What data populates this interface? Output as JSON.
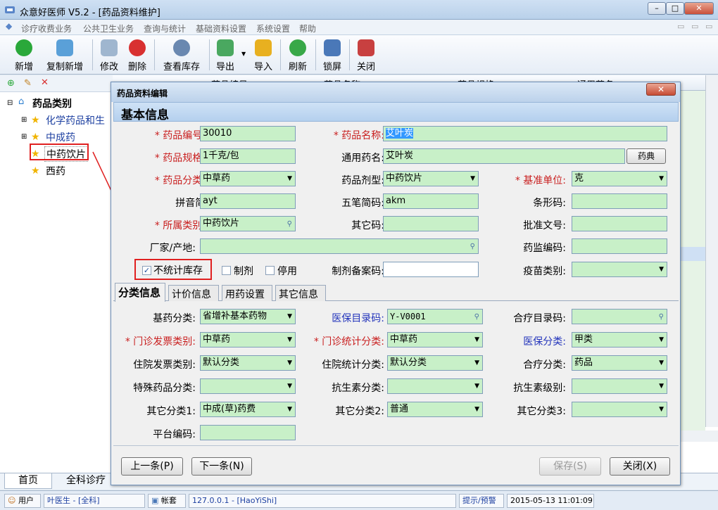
{
  "window": {
    "title": "众意好医师 V5.2 - [药品资料维护]"
  },
  "menu": [
    "诊疗收费业务",
    "公共卫生业务",
    "查询与统计",
    "基础资料设置",
    "系统设置",
    "帮助"
  ],
  "toolbar": [
    {
      "label": "新增",
      "icon": "add-icon"
    },
    {
      "label": "复制新增",
      "icon": "copy-icon"
    },
    {
      "label": "修改",
      "icon": "edit-icon"
    },
    {
      "label": "删除",
      "icon": "delete-icon"
    },
    {
      "label": "查看库存",
      "icon": "inventory-icon"
    },
    {
      "label": "导出",
      "icon": "export-icon"
    },
    {
      "label": "导入",
      "icon": "import-icon"
    },
    {
      "label": "刷新",
      "icon": "refresh-icon"
    },
    {
      "label": "锁屏",
      "icon": "lock-screen-icon"
    },
    {
      "label": "关闭",
      "icon": "exit-icon"
    }
  ],
  "tree": {
    "root": "药品类别",
    "items": [
      "化学药品和生",
      "中成药",
      "中药饮片",
      "西药"
    ]
  },
  "bottom_tabs": [
    "首页",
    "全科诊疗"
  ],
  "status": {
    "user_label": "用户",
    "user": "叶医生 - [全科]",
    "account_label": "帐套",
    "account": "127.0.0.1 - [HaoYiShi]",
    "hint": "提示/预警",
    "datetime": "2015-05-13 11:01:09"
  },
  "dialog": {
    "title": "药品资料编辑",
    "close": "✕",
    "section": "基本信息",
    "labels": {
      "code": "药品编号:",
      "name": "药品名称:",
      "spec": "药品规格:",
      "generic": "通用药名:",
      "category": "药品分类:",
      "dosage": "药品剂型:",
      "unit": "基准单位:",
      "pinyin": "拼音简码:",
      "wubi": "五笔简码:",
      "barcode": "条形码:",
      "subcat": "所属类别:",
      "othercode": "其它码:",
      "approval": "批准文号:",
      "maker": "厂家/产地:",
      "supervision": "药监编码:",
      "nostock": "不统计库存",
      "prep": "制剂",
      "stopped": "停用",
      "prep_record": "制剂备案码:",
      "vaccine": "疫苗类别:"
    },
    "values": {
      "code": "30010",
      "name": "艾叶炭",
      "spec": "1千克/包",
      "generic": "艾叶炭",
      "category": "中草药",
      "dosage": "中药饮片",
      "unit": "克",
      "pinyin": "ayt",
      "wubi": "akm",
      "barcode": "",
      "subcat": "中药饮片",
      "othercode": "",
      "approval": "",
      "maker": "",
      "supervision": "",
      "prep_record": "",
      "vaccine": ""
    },
    "checks": {
      "nostock": true,
      "prep": false,
      "stopped": false
    },
    "pharmacopoeia_button": "药典",
    "tabs": [
      "分类信息",
      "计价信息",
      "用药设置",
      "其它信息"
    ],
    "class_labels": {
      "basic": "基药分类:",
      "insurance_dir": "医保目录码:",
      "coop_dir": "合疗目录码:",
      "op_invoice": "门诊发票类别:",
      "op_stat": "门诊统计分类:",
      "insurance_cls": "医保分类:",
      "ip_invoice": "住院发票类别:",
      "ip_stat": "住院统计分类:",
      "coop_cls": "合疗分类:",
      "special": "特殊药品分类:",
      "antibiotic": "抗生素分类:",
      "antibiotic_level": "抗生素级别:",
      "other1": "其它分类1:",
      "other2": "其它分类2:",
      "other3": "其它分类3:",
      "platform": "平台编码:"
    },
    "class_values": {
      "basic": "省增补基本药物",
      "insurance_dir": "Y-V0001",
      "coop_dir": "",
      "op_invoice": "中草药",
      "op_stat": "中草药",
      "insurance_cls": "甲类",
      "ip_invoice": "默认分类",
      "ip_stat": "默认分类",
      "coop_cls": "药品",
      "special": "",
      "antibiotic": "",
      "antibiotic_level": "",
      "other1": "中成(草)药费",
      "other2": "普通",
      "other3": "",
      "platform": ""
    },
    "buttons": {
      "prev": "上一条(P)",
      "next": "下一条(N)",
      "save": "保存(S)",
      "close": "关闭(X)"
    }
  },
  "grid_headers": [
    "药品编号",
    "药品名称",
    "药品规格",
    "通用药名"
  ]
}
